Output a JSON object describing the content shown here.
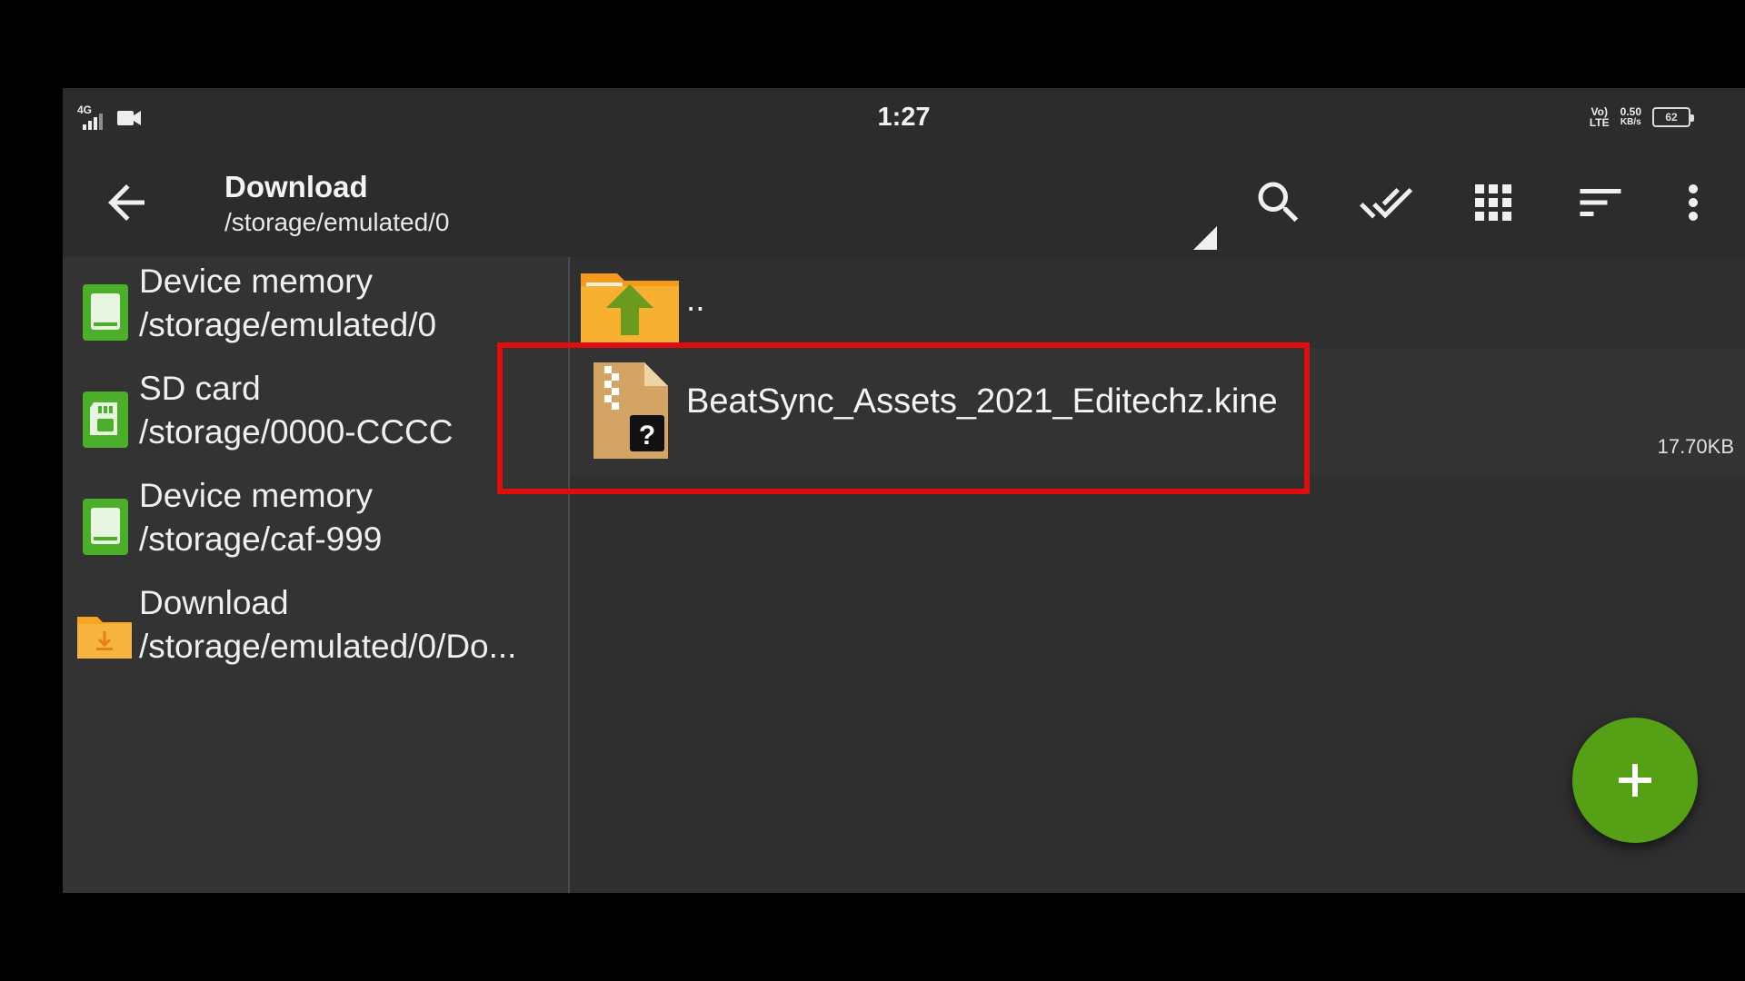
{
  "status_bar": {
    "network": "4G",
    "clock": "1:27",
    "volte_top": "Vo)",
    "volte_bottom": "LTE",
    "speed_value": "0.50",
    "speed_unit": "KB/s",
    "battery_level": "62",
    "icons": [
      "signal-icon",
      "video-call-icon",
      "volte-icon",
      "battery-icon"
    ]
  },
  "toolbar": {
    "title": "Download",
    "subtitle": "/storage/emulated/0",
    "actions": [
      "back-arrow-icon",
      "search-icon",
      "double-check-icon",
      "grid-view-icon",
      "sort-icon",
      "more-vert-icon"
    ]
  },
  "sidebar": {
    "items": [
      {
        "name": "Device memory",
        "path": "/storage/emulated/0",
        "icon": "phone-storage-icon"
      },
      {
        "name": "SD card",
        "path": "/storage/0000-CCCC",
        "icon": "sd-card-icon"
      },
      {
        "name": "Device memory",
        "path": "/storage/caf-999",
        "icon": "phone-storage-icon"
      },
      {
        "name": "Download",
        "path": "/storage/emulated/0/Do...",
        "icon": "download-folder-icon"
      }
    ]
  },
  "files": {
    "parent": {
      "label": "..",
      "icon": "parent-folder-up-icon"
    },
    "items": [
      {
        "name": "BeatSync_Assets_2021_Editechz.kine",
        "size": "17.70KB",
        "icon": "unknown-archive-icon"
      }
    ]
  },
  "fab": {
    "icon": "plus-icon"
  },
  "colors": {
    "background": "#2f2f2f",
    "toolbar": "#2c2c2c",
    "accent_green": "#56a015",
    "folder_orange": "#f5a623",
    "highlight_red": "#e00d0d"
  }
}
